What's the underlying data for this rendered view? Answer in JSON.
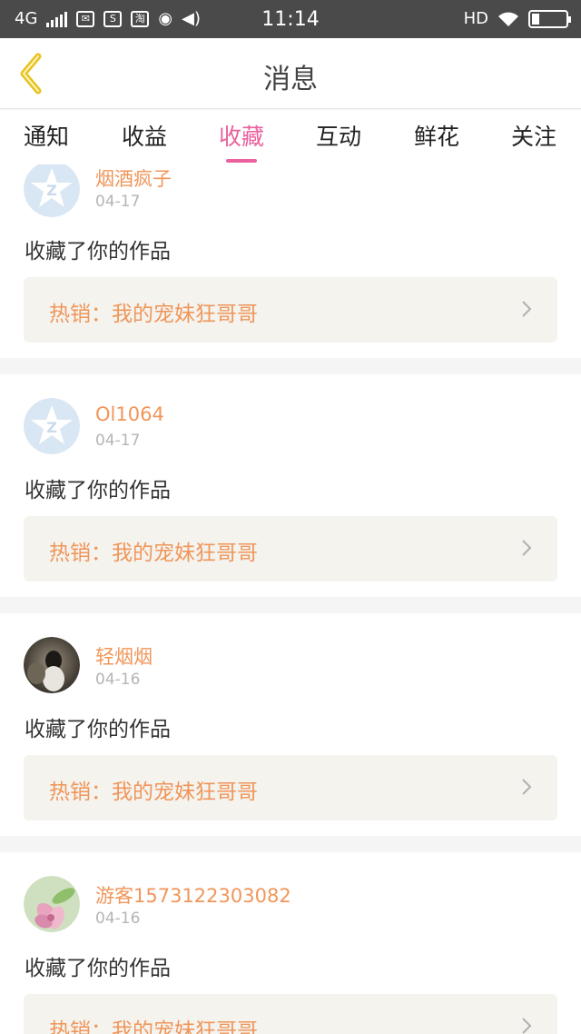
{
  "status_bar": {
    "network": "4G",
    "app_icons": [
      "mail-icon",
      "s-app-icon",
      "taobao-icon",
      "wechat-icon",
      "volume-icon"
    ],
    "time": "11:14",
    "hd": "HD"
  },
  "nav": {
    "title": "消息"
  },
  "tabs": [
    {
      "label": "通知"
    },
    {
      "label": "收益"
    },
    {
      "label": "收藏"
    },
    {
      "label": "互动"
    },
    {
      "label": "鲜花"
    },
    {
      "label": "关注"
    }
  ],
  "active_tab": "收藏",
  "messages": [
    {
      "user": "烟酒疯子",
      "date": "04-17",
      "text": "收藏了你的作品",
      "work": "热销：我的宠妹狂哥哥",
      "avatar": "default"
    },
    {
      "user": "Ol1064",
      "date": "04-17",
      "text": "收藏了你的作品",
      "work": "热销：我的宠妹狂哥哥",
      "avatar": "default"
    },
    {
      "user": "轻烟烟",
      "date": "04-16",
      "text": "收藏了你的作品",
      "work": "热销：我的宠妹狂哥哥",
      "avatar": "photo"
    },
    {
      "user": "游客1573122303082",
      "date": "04-16",
      "text": "收藏了你的作品",
      "work": "热销：我的宠妹狂哥哥",
      "avatar": "flower"
    }
  ],
  "colors": {
    "accent": "#e9619e",
    "name": "#f0965a",
    "back_arrow": "#e8c21e"
  }
}
